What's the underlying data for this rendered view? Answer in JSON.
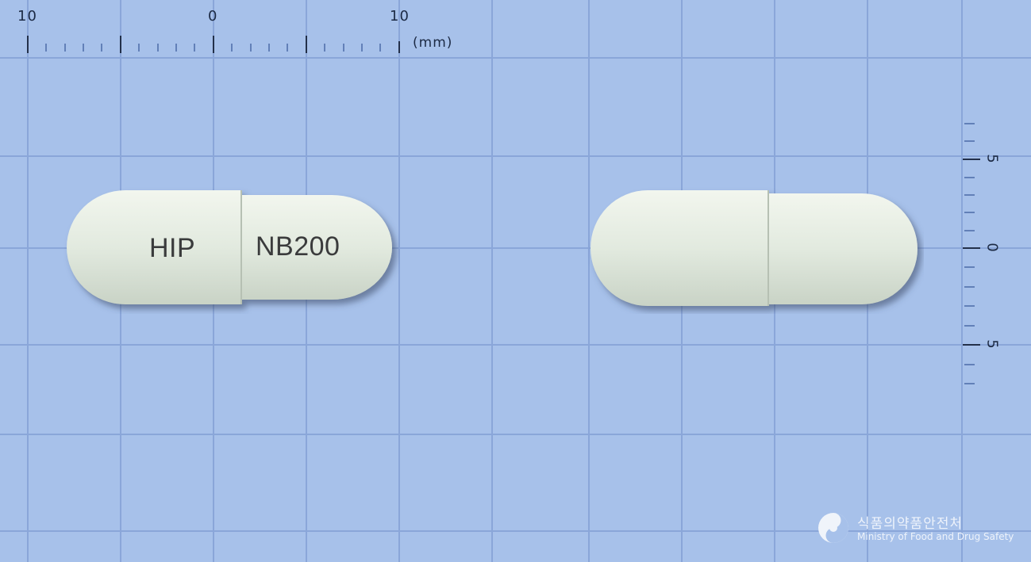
{
  "ruler": {
    "horizontal_labels": [
      "10",
      "0",
      "10"
    ],
    "unit": "(mm)",
    "vertical_labels": [
      "5",
      "0",
      "5"
    ]
  },
  "capsules": [
    {
      "view": "front",
      "imprint_cap": "HIP",
      "imprint_body": "NB200",
      "color": "#e3ebe1"
    },
    {
      "view": "back",
      "imprint_cap": "",
      "imprint_body": "",
      "color": "#e3ebe1"
    }
  ],
  "logo": {
    "korean": "식품의약품안전처",
    "english": "Ministry of Food and Drug Safety"
  }
}
